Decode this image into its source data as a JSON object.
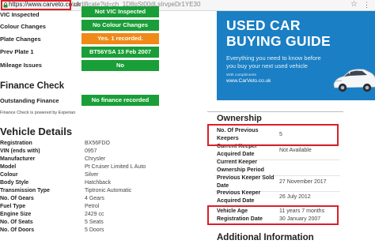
{
  "address_bar": {
    "host": "https://www.carveto.co.uk",
    "path": "/certificate?id=ch_1D8pSt00dLsIrvpeDr1YE30"
  },
  "colors": {
    "green_badge": "#1a9e38",
    "orange_badge": "#ef8a17",
    "ad_background": "#1a7fc4",
    "highlight": "#d8202a"
  },
  "checks": [
    {
      "label": "VIC Inspected",
      "status": "Not VIC Inspected",
      "color": "green"
    },
    {
      "label": "Colour Changes",
      "status": "No Colour Changes",
      "color": "green"
    },
    {
      "label": "Plate Changes",
      "status": "Yes. 1 recorded.",
      "color": "orange"
    },
    {
      "label": "Prev Plate 1",
      "status": "BT56YSA 13 Feb 2007",
      "color": "green"
    },
    {
      "label": "Mileage Issues",
      "status": "No",
      "color": "green"
    }
  ],
  "finance": {
    "title": "Finance Check",
    "label": "Outstanding Finance",
    "status": "No finance recorded",
    "note": "Finance Check is powered by Experian"
  },
  "vehicle": {
    "title": "Vehicle Details",
    "rows": [
      {
        "label": "Registration",
        "value": "BX56FDO"
      },
      {
        "label": "VIN (ends with)",
        "value": "0957"
      },
      {
        "label": "Manufacturer",
        "value": "Chrysler"
      },
      {
        "label": "Model",
        "value": "Pt Cruiser Limited L Auto"
      },
      {
        "label": "Colour",
        "value": "Silver"
      },
      {
        "label": "Body Style",
        "value": "Hatchback"
      },
      {
        "label": "Transmission Type",
        "value": "Tiptronic Automatic"
      },
      {
        "label": "No. Of Gears",
        "value": "4 Gears"
      },
      {
        "label": "Fuel Type",
        "value": "Petrol"
      },
      {
        "label": "Engine Size",
        "value": "2429 cc"
      },
      {
        "label": "No. Of Seats",
        "value": "5 Seats"
      },
      {
        "label": "No. Of Doors",
        "value": "5 Doors"
      }
    ]
  },
  "ad": {
    "title_line1": "USED CAR",
    "title_line2": "BUYING GUIDE",
    "sub_line1": "Everything you need to know before",
    "sub_line2": "you buy your next used vehicle",
    "compliments": "With compliments",
    "url": "www.CarVeto.co.uk"
  },
  "ownership": {
    "title": "Ownership",
    "rows": [
      {
        "label_lines": [
          "No. Of Previous",
          "Keepers"
        ],
        "value": "5"
      },
      {
        "label_lines": [
          "Current Keeper",
          "Acquired Date"
        ],
        "value": "Not Available"
      },
      {
        "label_lines": [
          "Current Keeper",
          "Ownership Period"
        ],
        "value": ""
      },
      {
        "label_lines": [
          "Previous Keeper Sold",
          "Date"
        ],
        "value": "27 November 2017"
      },
      {
        "label_lines": [
          "Previous Keeper",
          "Acquired Date"
        ],
        "value": "26 July 2012"
      },
      {
        "label_lines": [
          "Vehicle Age"
        ],
        "value": "11 years 7 months"
      },
      {
        "label_lines": [
          "Registration Date"
        ],
        "value": "30 January 2007"
      }
    ]
  },
  "additional": {
    "title": "Additional Information"
  }
}
